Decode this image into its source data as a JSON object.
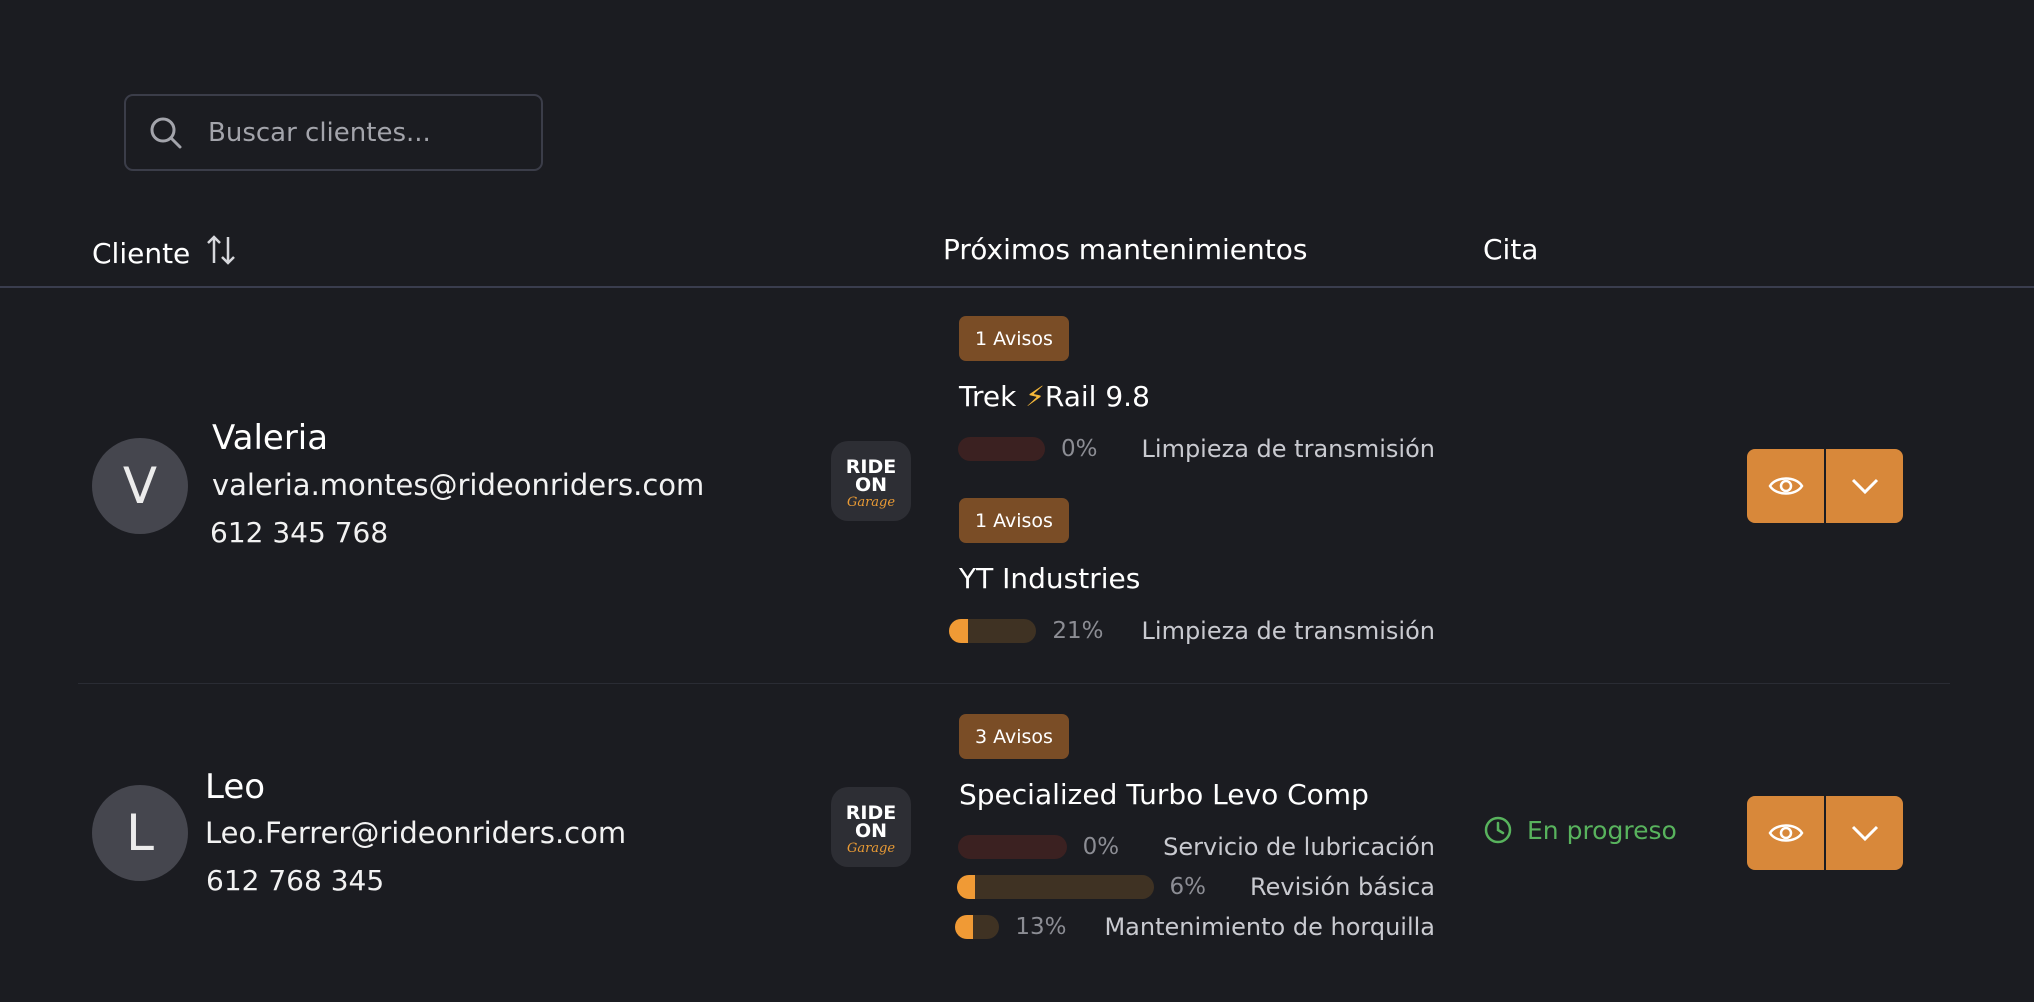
{
  "search": {
    "placeholder": "Buscar clientes..."
  },
  "table": {
    "headers": {
      "client": "Cliente",
      "maintenance": "Próximos mantenimientos",
      "appointment": "Cita"
    }
  },
  "logo": {
    "line1": "RIDE",
    "line2": "ON",
    "line3": "Garage"
  },
  "clients": [
    {
      "initial": "V",
      "name": "Valeria",
      "email": "valeria.montes@rideonriders.com",
      "phone": "612 345 768",
      "appointment": "",
      "bikes": [
        {
          "badge": "1 Avisos",
          "name_a": "Trek ",
          "bolt": "⚡",
          "name_b": "Rail 9.8",
          "tasks": [
            {
              "percent": 0,
              "percent_label": "0%",
              "name": "Limpieza de transmisión",
              "bar_color": "#3b2121"
            }
          ]
        },
        {
          "badge": "1 Avisos",
          "name": "YT Industries",
          "tasks": [
            {
              "percent": 21,
              "percent_label": "21%",
              "name": "Limpieza de transmisión",
              "bar_color": "#3f3223"
            }
          ]
        }
      ]
    },
    {
      "initial": "L",
      "name": "Leo",
      "email": "Leo.Ferrer@rideonriders.com",
      "phone": "612 768 345",
      "appointment": "En progreso",
      "bikes": [
        {
          "badge": "3 Avisos",
          "name": "Specialized Turbo Levo Comp",
          "tasks": [
            {
              "percent": 0,
              "percent_label": "0%",
              "name": "Servicio de lubricación",
              "bar_color": "#3b2121"
            },
            {
              "percent": 6,
              "percent_label": "6%",
              "name": "Revisión básica",
              "bar_color": "#3f3223"
            },
            {
              "percent": 13,
              "percent_label": "13%",
              "name": "Mantenimiento de horquilla",
              "bar_color": "#3f3223"
            }
          ]
        }
      ]
    }
  ],
  "colors": {
    "accent": "#d8883a",
    "progress": "#f09a35",
    "badge": "#7a4d26",
    "status": "#58b35d"
  },
  "icons": {
    "search": "search-icon",
    "sort": "sort-icon",
    "view": "eye-icon",
    "expand": "chevron-down-icon",
    "status": "clock-icon"
  }
}
